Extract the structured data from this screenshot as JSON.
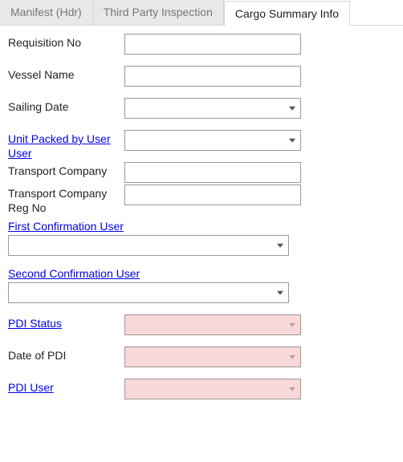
{
  "tabs": {
    "manifest": "Manifest (Hdr)",
    "tpi": "Third Party Inspection",
    "cargo": "Cargo Summary Info",
    "active": "cargo"
  },
  "fields": {
    "requisition_no": {
      "label": "Requisition No",
      "value": ""
    },
    "vessel_name": {
      "label": "Vessel Name",
      "value": ""
    },
    "sailing_date": {
      "label": "Sailing Date",
      "value": ""
    },
    "unit_packed_by": {
      "label": "Unit Packed by User User",
      "value": ""
    },
    "transport_company": {
      "label": "Transport Company",
      "value": ""
    },
    "transport_company_reg_no": {
      "label": "Transport Company Reg No",
      "value": ""
    },
    "first_confirmation_user": {
      "label": "First Confirmation User",
      "value": ""
    },
    "second_confirmation_user": {
      "label": "Second Confirmation User",
      "value": ""
    },
    "pdi_status": {
      "label": "PDI Status",
      "value": ""
    },
    "date_of_pdi": {
      "label": "Date of PDI",
      "value": ""
    },
    "pdi_user": {
      "label": "PDI User",
      "value": ""
    }
  }
}
